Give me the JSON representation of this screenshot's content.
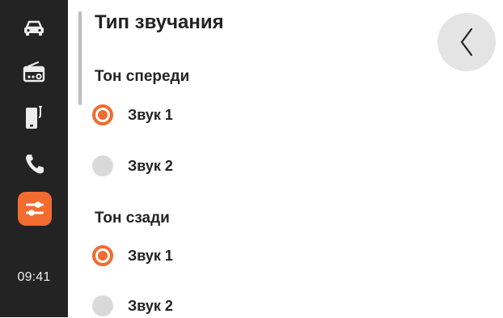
{
  "sidebar": {
    "items": [
      {
        "icon": "car-icon"
      },
      {
        "icon": "radio-icon"
      },
      {
        "icon": "phone-device-icon"
      },
      {
        "icon": "phone-call-icon"
      },
      {
        "icon": "sliders-icon",
        "active": true
      }
    ],
    "time": "09:41"
  },
  "header": {
    "title": "Тип звучания",
    "back_icon": "chevron-left-icon"
  },
  "sections": [
    {
      "title": "Тон спереди",
      "options": [
        {
          "label": "Звук 1",
          "selected": true
        },
        {
          "label": "Звук 2",
          "selected": false
        }
      ]
    },
    {
      "title": "Тон сзади",
      "options": [
        {
          "label": "Звук 1",
          "selected": true
        },
        {
          "label": "Звук 2",
          "selected": false
        }
      ]
    }
  ],
  "colors": {
    "accent": "#f26b2f",
    "sidebar_bg": "#232323",
    "radio_off": "#d9d9d9"
  }
}
